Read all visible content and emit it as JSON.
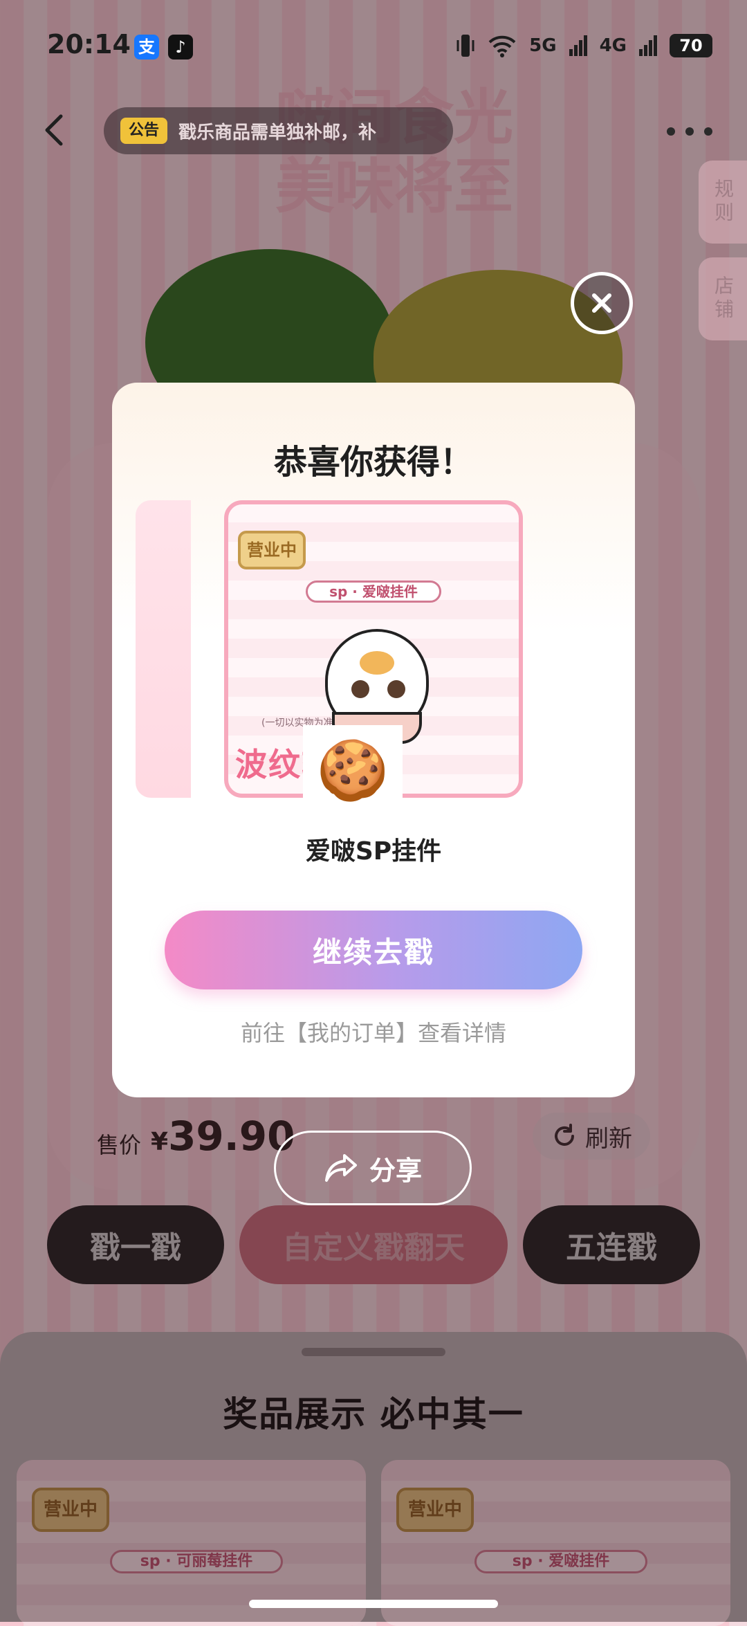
{
  "status_bar": {
    "time": "20:14",
    "app_icon_1": "支",
    "app_icon_2": "♪",
    "signal_5g": "5G",
    "signal_4g": "4G",
    "battery": "70"
  },
  "header": {
    "notice_tag": "公告",
    "notice_text": "戳乐商品需单独补邮，补",
    "side_tab_rules": "规则",
    "side_tab_store": "店铺"
  },
  "background": {
    "title_line1": "啵间食光",
    "title_line2": "美味将至"
  },
  "price": {
    "label": "售价",
    "currency": "¥",
    "amount": "39.90",
    "refresh_label": "刷新"
  },
  "share_label": "分享",
  "draw_buttons": {
    "single": "戳一戳",
    "custom": "自定义戳翻天",
    "five": "五连戳"
  },
  "prize_sheet": {
    "title": "奖品展示 必中其一",
    "cards": [
      {
        "tag": "营业中",
        "label": "sp · 可丽莓挂件"
      },
      {
        "tag": "营业中",
        "label": "sp · 爱啵挂件"
      }
    ]
  },
  "modal": {
    "title": "恭喜你获得！",
    "card_tag": "营业中",
    "card_label": "sp · 爱啵挂件",
    "card_note": "(一切以实物为准)",
    "card_brand": "波纹轻食碗",
    "prize_name": "爱啵SP挂件",
    "continue_label": "继续去戳",
    "hint": "前往【我的订单】查看详情"
  },
  "colors": {
    "accent_gradient_start": "#f48ac6",
    "accent_gradient_end": "#8ea7f2",
    "dark_button": "#222222"
  }
}
